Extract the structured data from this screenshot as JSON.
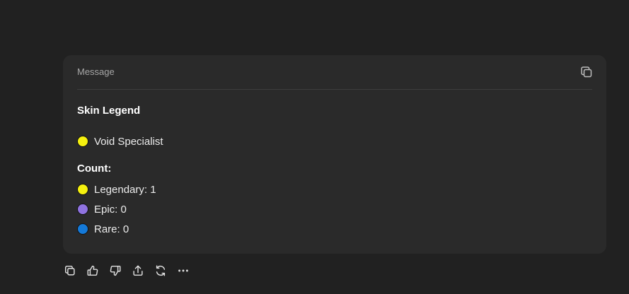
{
  "message": {
    "header_label": "Message",
    "heading": "Skin Legend",
    "featured": {
      "label": "Void Specialist",
      "color": "#f5f00f"
    },
    "count_heading": "Count:",
    "counts": [
      {
        "label": "Legendary: 1",
        "color": "#f5f00f"
      },
      {
        "label": "Epic: 0",
        "color": "#8f73e0"
      },
      {
        "label": "Rare: 0",
        "color": "#1479d8"
      }
    ]
  },
  "actions": [
    "copy-icon",
    "thumbs-up-icon",
    "thumbs-down-icon",
    "share-icon",
    "regenerate-icon",
    "more-icon"
  ]
}
